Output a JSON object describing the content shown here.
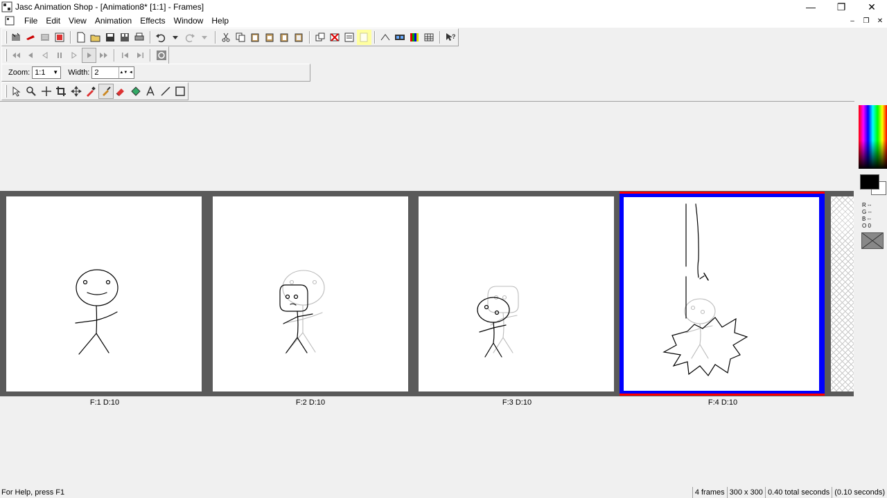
{
  "window": {
    "title": "Jasc Animation Shop - [Animation8* [1:1] - Frames]",
    "minimize_glyph": "—",
    "restore_glyph": "❐",
    "close_glyph": "✕"
  },
  "menu": {
    "items": [
      "File",
      "Edit",
      "View",
      "Animation",
      "Effects",
      "Window",
      "Help"
    ],
    "mdi_minimize": "–",
    "mdi_restore": "❐",
    "mdi_close": "✕"
  },
  "zoombar": {
    "zoom_label": "Zoom:",
    "zoom_value": "1:1",
    "width_label": "Width:",
    "width_value": "2"
  },
  "frames": [
    {
      "label": "F:1  D:10"
    },
    {
      "label": "F:2  D:10"
    },
    {
      "label": "F:3  D:10"
    },
    {
      "label": "F:4  D:10"
    }
  ],
  "palette": {
    "r": "R --",
    "g": "G --",
    "b": "B --",
    "o": "O 0"
  },
  "status": {
    "help": "For Help, press F1",
    "frames": "4 frames",
    "size": "300 x 300",
    "total": "0.40 total seconds",
    "per_frame": "(0.10 seconds)"
  },
  "colors": {
    "selection_outer": "#ff0000",
    "selection_inner": "#0000ff",
    "strip_bg": "#5a5a5a"
  }
}
